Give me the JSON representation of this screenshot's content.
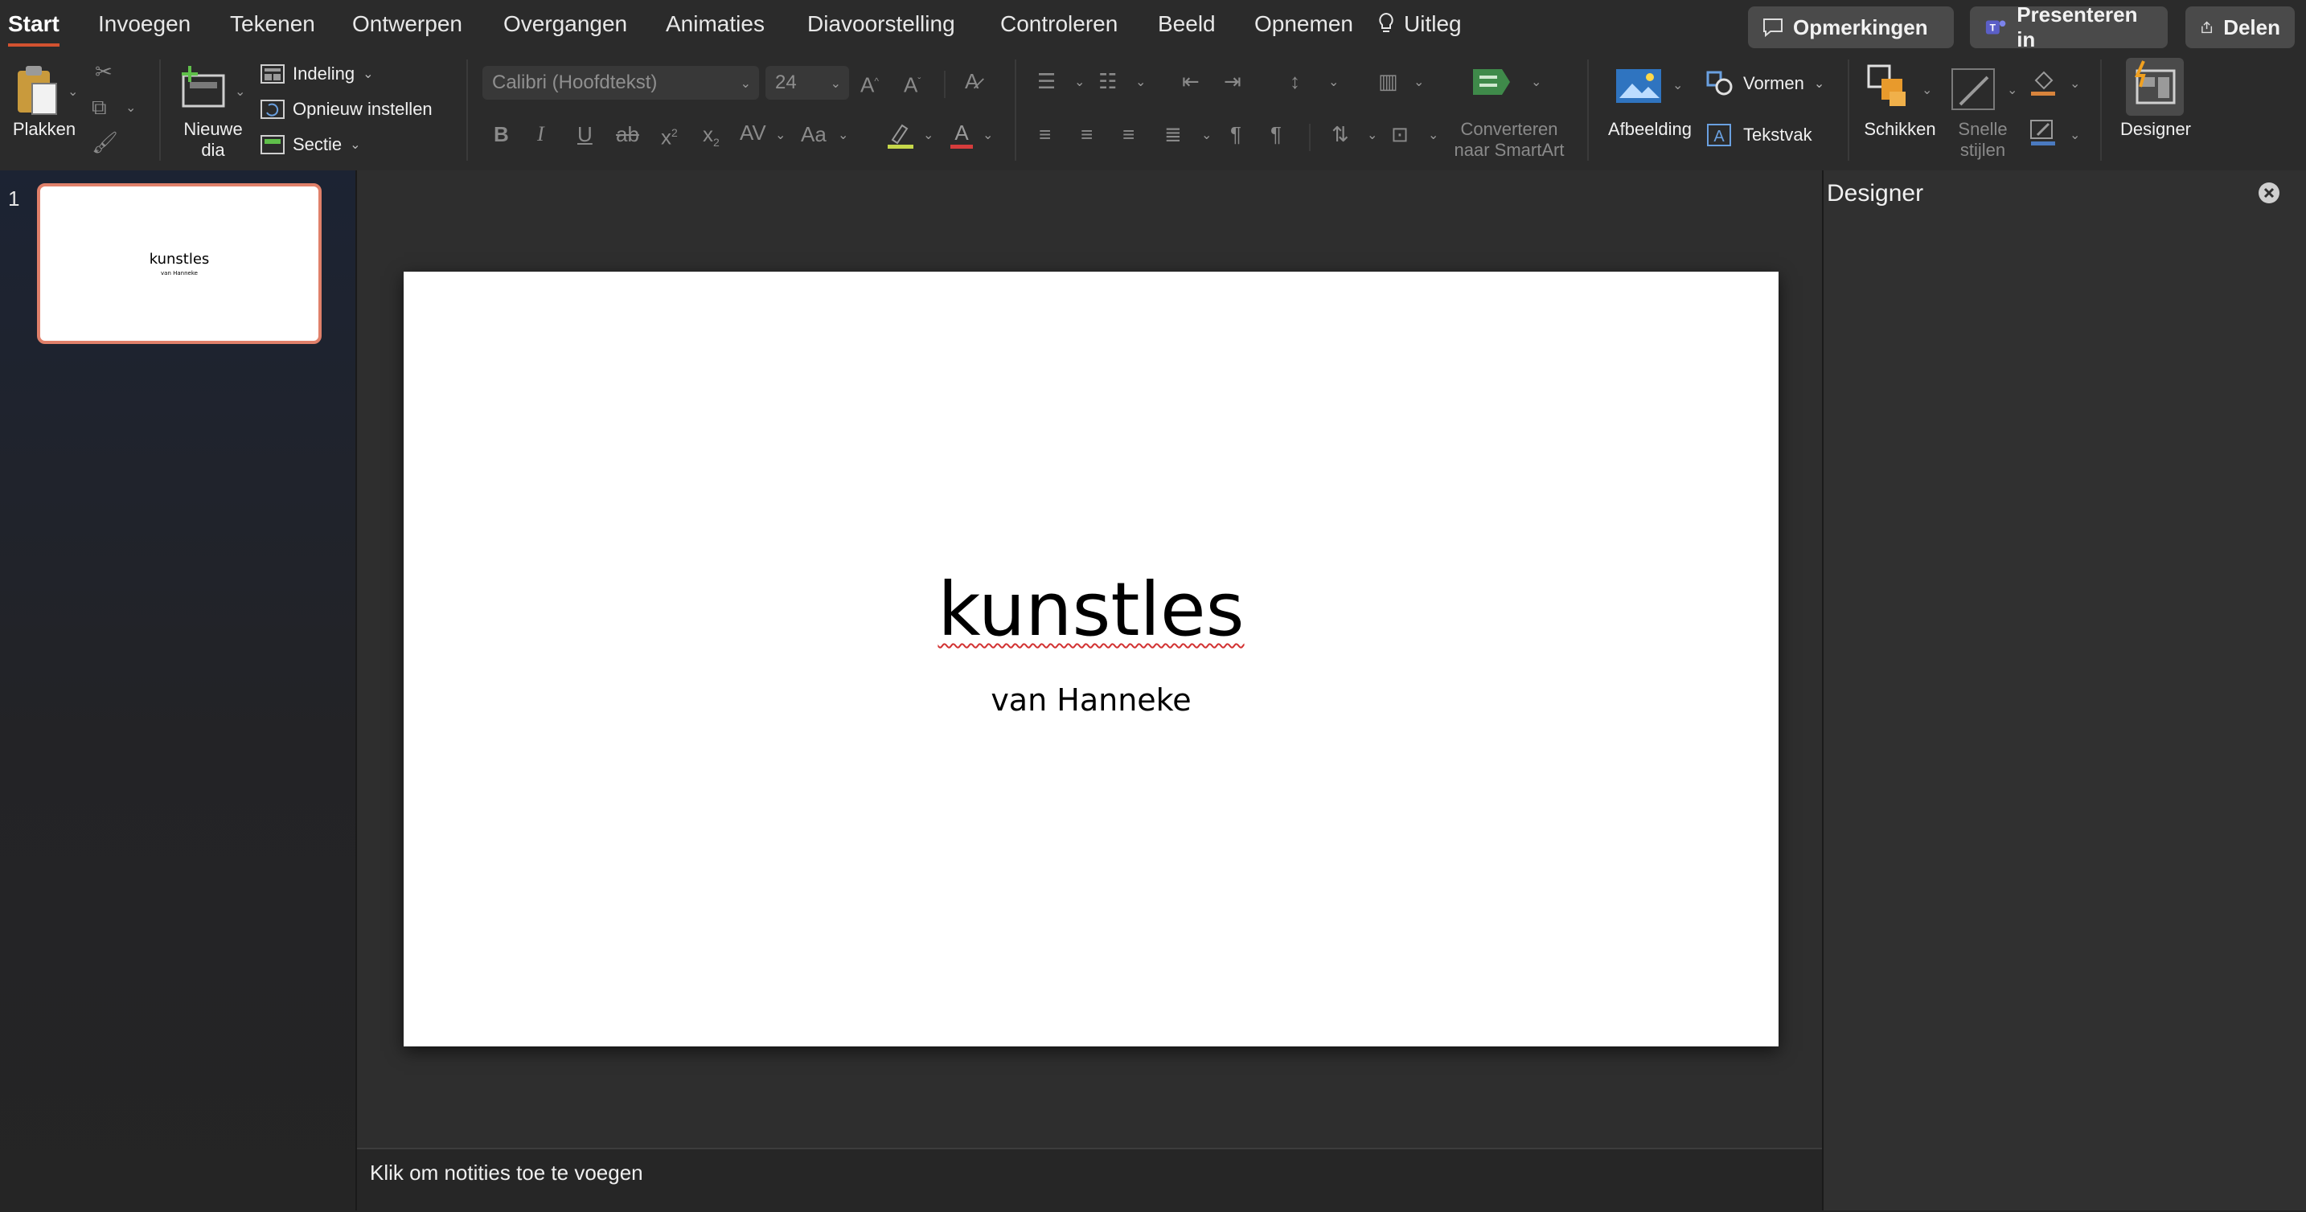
{
  "tabs": [
    {
      "label": "Start",
      "active": true
    },
    {
      "label": "Invoegen"
    },
    {
      "label": "Tekenen"
    },
    {
      "label": "Ontwerpen"
    },
    {
      "label": "Overgangen"
    },
    {
      "label": "Animaties"
    },
    {
      "label": "Diavoorstelling"
    },
    {
      "label": "Controleren"
    },
    {
      "label": "Beeld"
    },
    {
      "label": "Opnemen"
    }
  ],
  "tell_me": {
    "label": "Uitleg",
    "icon": "lightbulb-icon"
  },
  "top_buttons": {
    "comments": "Opmerkingen",
    "present": "Presenteren in",
    "share": "Delen"
  },
  "ribbon": {
    "paste": "Plakken",
    "new_slide_line1": "Nieuwe",
    "new_slide_line2": "dia",
    "layout": "Indeling",
    "reset": "Opnieuw instellen",
    "section": "Sectie",
    "font_name": "Calibri (Hoofdtekst)",
    "font_size": "24",
    "convert_line1": "Converteren",
    "convert_line2": "naar SmartArt",
    "picture": "Afbeelding",
    "shapes": "Vormen",
    "textbox": "Tekstvak",
    "arrange": "Schikken",
    "quick_styles_line1": "Snelle",
    "quick_styles_line2": "stijlen",
    "designer": "Designer"
  },
  "thumbnail": {
    "number": "1",
    "title": "kunstles",
    "subtitle": "van Hanneke"
  },
  "slide": {
    "title": "kunstles",
    "subtitle": "van Hanneke"
  },
  "notes": {
    "placeholder": "Klik om notities toe te voegen"
  },
  "designer_pane": {
    "title": "Designer"
  },
  "colors": {
    "accent": "#d35230",
    "background": "#262626",
    "slide": "#ffffff"
  }
}
